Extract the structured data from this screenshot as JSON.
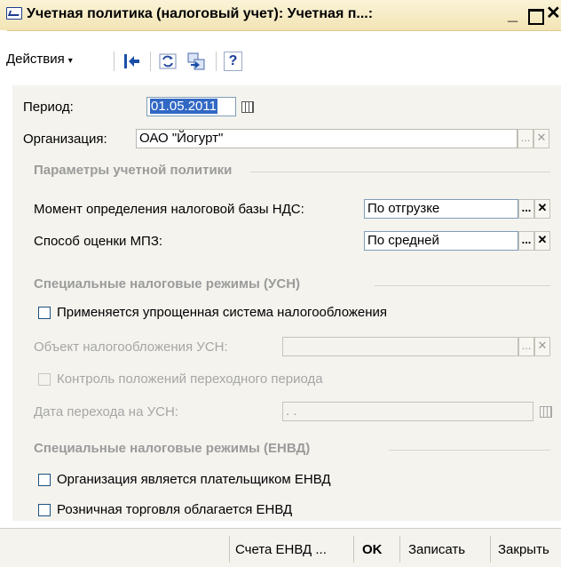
{
  "window": {
    "title": "Учетная политика (налоговый учет): Учетная п...:",
    "minimize_glyph": "_",
    "close_glyph": "✕"
  },
  "toolbar": {
    "actions_label": "Действия",
    "actions_arrow": "▾",
    "help_glyph": "?"
  },
  "form": {
    "period_label": "Период:",
    "period_value": "01.05.2011",
    "org_label": "Организация:",
    "org_value": "ОАО \"Йогурт\"",
    "section_params": "Параметры учетной политики",
    "vat_label": "Момент определения налоговой базы НДС:",
    "vat_value": "По отгрузке",
    "mpz_label": "Способ оценки МПЗ:",
    "mpz_value": "По средней",
    "section_usn": "Специальные налоговые режимы (УСН)",
    "usn_check_label": "Применяется упрощенная система налогообложения",
    "usn_object_label": "Объект налогообложения УСН:",
    "usn_object_value": "",
    "transition_check_label": "Контроль положений переходного периода",
    "usn_date_label": "Дата перехода на УСН:",
    "usn_date_value": " .  .",
    "section_envd": "Специальные налоговые режимы (ЕНВД)",
    "envd_payer_label": "Организация является плательщиком ЕНВД",
    "envd_retail_label": "Розничная торговля облагается ЕНВД",
    "select_glyph": "...",
    "clear_glyph": "✕"
  },
  "footer": {
    "envd_accounts_label": "Счета ЕНВД ...",
    "ok_label": "OK",
    "save_label": "Записать",
    "close_label": "Закрыть"
  },
  "colors": {
    "title_bar": "#f2e4b4",
    "panel_bg": "#f4f3ee",
    "field_border": "#7f9db9",
    "selection": "#3168c4",
    "section_text": "#9b9b9b"
  }
}
